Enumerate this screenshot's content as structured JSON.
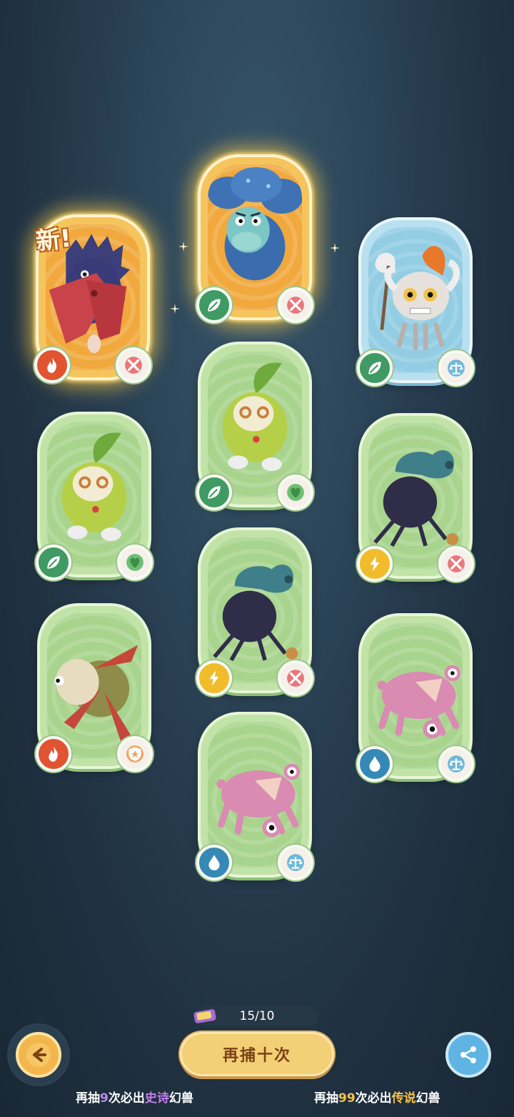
{
  "cards": [
    {
      "id": "c1",
      "rarity": "legend",
      "element": "fire",
      "trait": "attack",
      "is_new": true,
      "creature": "pelican"
    },
    {
      "id": "c2",
      "rarity": "legend",
      "element": "grass",
      "trait": "attack",
      "is_new": false,
      "creature": "blue-mushroom"
    },
    {
      "id": "c3",
      "rarity": "rare",
      "element": "grass",
      "trait": "balance",
      "is_new": false,
      "creature": "skull-warrior"
    },
    {
      "id": "c4",
      "rarity": "common",
      "element": "grass",
      "trait": "heal",
      "is_new": false,
      "creature": "leaf-sprout"
    },
    {
      "id": "c5",
      "rarity": "common",
      "element": "grass",
      "trait": "heal",
      "is_new": false,
      "creature": "leaf-sprout"
    },
    {
      "id": "c6",
      "rarity": "common",
      "element": "electric",
      "trait": "attack",
      "is_new": false,
      "creature": "shell-beast"
    },
    {
      "id": "c7",
      "rarity": "common",
      "element": "fire",
      "trait": "defense",
      "is_new": false,
      "creature": "red-starfish"
    },
    {
      "id": "c8",
      "rarity": "common",
      "element": "electric",
      "trait": "attack",
      "is_new": false,
      "creature": "shell-beast"
    },
    {
      "id": "c9",
      "rarity": "common",
      "element": "water",
      "trait": "balance",
      "is_new": false,
      "creature": "pink-pig"
    },
    {
      "id": "c10",
      "rarity": "common",
      "element": "water",
      "trait": "balance",
      "is_new": false,
      "creature": "pink-pig"
    }
  ],
  "new_label": "新!",
  "counter": {
    "value": "15/10",
    "icon": "ticket-icon"
  },
  "retry_button": {
    "label": "再捕十次"
  },
  "back_button": {
    "icon": "back-arrow-icon"
  },
  "share_button": {
    "icon": "share-icon"
  },
  "hints": {
    "epic": {
      "prefix": "再抽",
      "count": "9",
      "middle": "次必出",
      "rarity": "史诗",
      "suffix": "幻兽"
    },
    "legendary": {
      "prefix": "再抽",
      "count": "99",
      "middle": "次必出",
      "rarity": "传说",
      "suffix": "幻兽"
    }
  },
  "colors": {
    "background": "#233646",
    "legend_card": "#f6c45c",
    "common_card": "#c2e3a8",
    "rare_card": "#b9e0ef",
    "retry_button": "#f3cf75"
  }
}
